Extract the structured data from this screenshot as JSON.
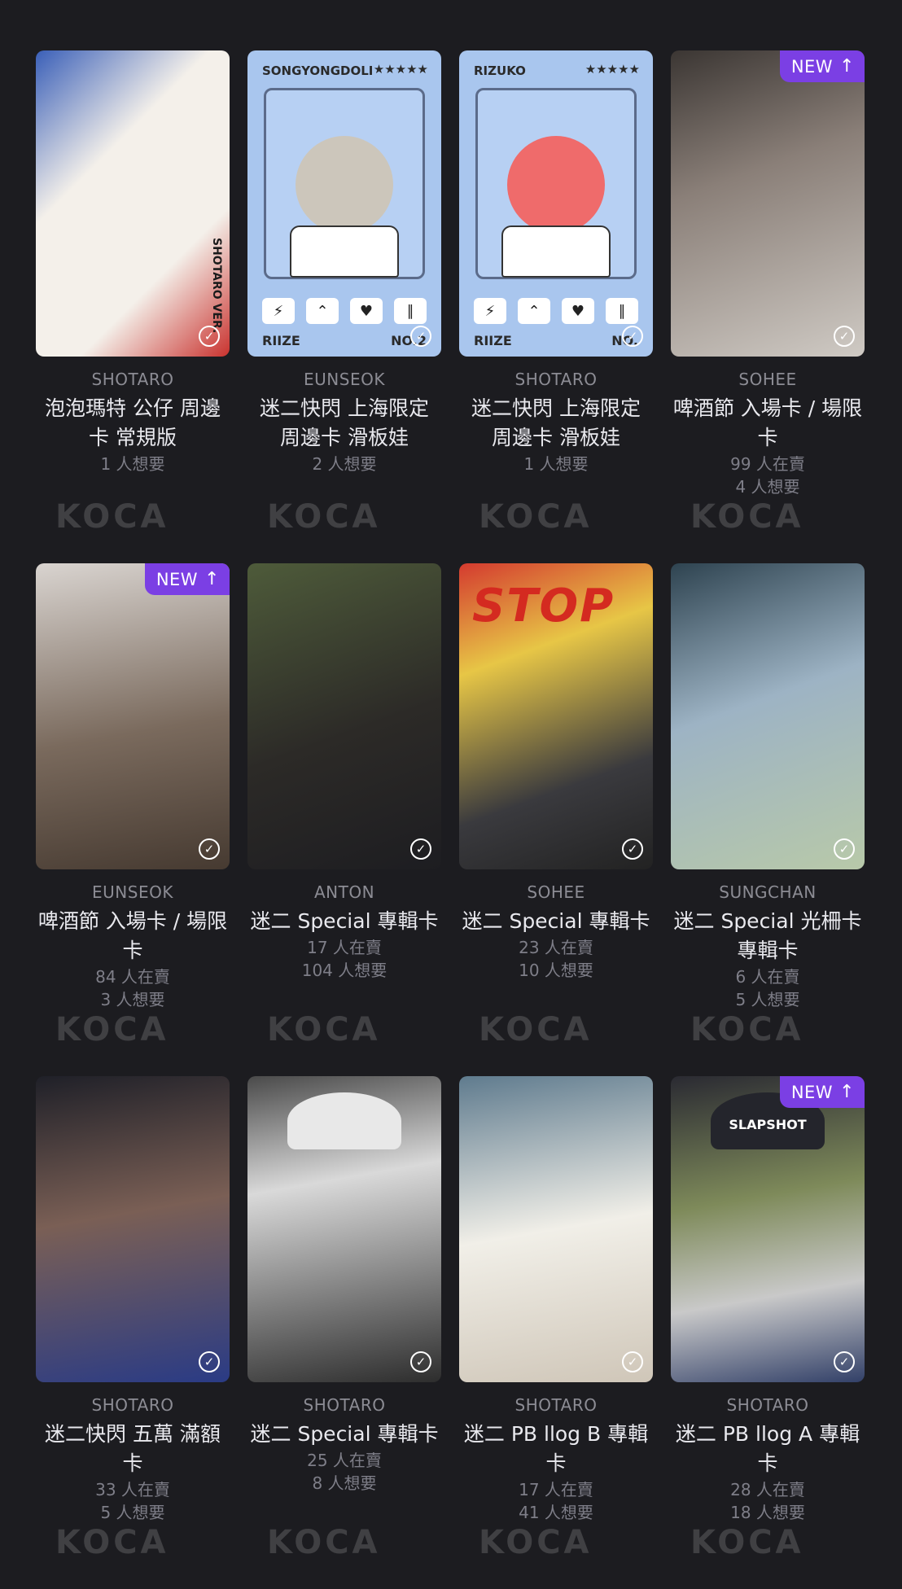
{
  "badge": {
    "new_label": "NEW",
    "new_arrow": "↑"
  },
  "watermark": "KOCA",
  "cards": [
    {
      "member": "SHOTARO",
      "title": "泡泡瑪特 公仔 周邊卡 常規版",
      "selling": "",
      "wanted": "1 人想要",
      "is_new": false,
      "art": "cartoon",
      "art_text": "SHOTARO VER."
    },
    {
      "member": "EUNSEOK",
      "title": "迷二快閃 上海限定 周邊卡 滑板娃",
      "selling": "",
      "wanted": "2 人想要",
      "is_new": false,
      "art": "blue",
      "card_name": "SONGYONGDOLI",
      "stars": "★★★★★",
      "brand": "RIIZE",
      "card_no": "NO.2"
    },
    {
      "member": "SHOTARO",
      "title": "迷二快閃 上海限定 周邊卡 滑板娃",
      "selling": "",
      "wanted": "1 人想要",
      "is_new": false,
      "art": "blue-red",
      "card_name": "RIZUKO",
      "stars": "★★★★★",
      "brand": "RIIZE",
      "card_no": "NO."
    },
    {
      "member": "SOHEE",
      "title": "啤酒節 入場卡 / 場限卡",
      "selling": "99 人在賣",
      "wanted": "4 人想要",
      "is_new": true,
      "art": "photo1"
    },
    {
      "member": "EUNSEOK",
      "title": "啤酒節 入場卡 / 場限卡",
      "selling": "84 人在賣",
      "wanted": "3 人想要",
      "is_new": true,
      "art": "photo2"
    },
    {
      "member": "ANTON",
      "title": "迷二 Special 專輯卡",
      "selling": "17 人在賣",
      "wanted": "104 人想要",
      "is_new": false,
      "art": "photo3"
    },
    {
      "member": "SOHEE",
      "title": "迷二 Special 專輯卡",
      "selling": "23 人在賣",
      "wanted": "10 人想要",
      "is_new": false,
      "art": "photo4",
      "art_text": "STOP"
    },
    {
      "member": "SUNGCHAN",
      "title": "迷二 Special 光柵卡 專輯卡",
      "selling": "6 人在賣",
      "wanted": "5 人想要",
      "is_new": false,
      "art": "photo5"
    },
    {
      "member": "SHOTARO",
      "title": "迷二快閃 五萬 滿額卡",
      "selling": "33 人在賣",
      "wanted": "5 人想要",
      "is_new": false,
      "art": "photo6"
    },
    {
      "member": "SHOTARO",
      "title": "迷二 Special 專輯卡",
      "selling": "25 人在賣",
      "wanted": "8 人想要",
      "is_new": false,
      "art": "photo7"
    },
    {
      "member": "SHOTARO",
      "title": "迷二 PB llog B 專輯卡",
      "selling": "17 人在賣",
      "wanted": "41 人想要",
      "is_new": false,
      "art": "photo8"
    },
    {
      "member": "SHOTARO",
      "title": "迷二 PB llog A 專輯卡",
      "selling": "28 人在賣",
      "wanted": "18 人想要",
      "is_new": true,
      "art": "photo9",
      "art_text": "SLAPSHOT"
    }
  ]
}
